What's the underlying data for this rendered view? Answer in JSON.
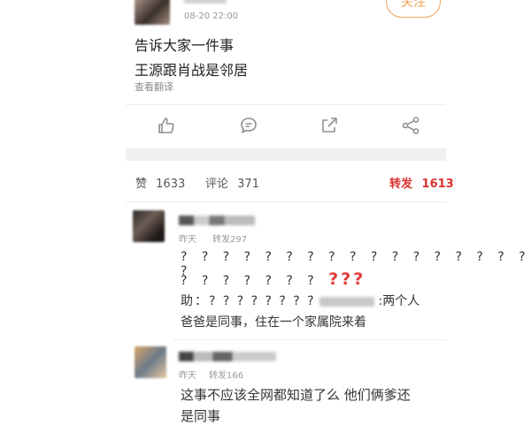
{
  "post": {
    "time": "08-20 22:00",
    "follow_label": "关注",
    "line1": "告诉大家一件事",
    "line2": "王源跟肖战是邻居",
    "translate_label": "查看翻译"
  },
  "stats": {
    "likes_label": "赞",
    "likes_count": "1633",
    "comments_label": "评论",
    "comments_count": "371",
    "reposts_label": "转发",
    "reposts_count": "1613"
  },
  "comments": [
    {
      "meta_time": "昨天",
      "meta_extra": "转发297",
      "q_line1": "? ? ? ? ? ? ? ? ? ? ? ? ? ? ? ? ? ?",
      "q_line2_plain": "? ? ? ? ? ? ?",
      "q_line2_red": "???",
      "reply_prefix": "助：? ? ? ? ? ? ? ?",
      "reply_suffix": ":两个人",
      "reply_line2": "爸爸是同事，住在一个家属院来着"
    },
    {
      "meta_time": "昨天",
      "meta_extra": "转发166",
      "line1": "这事不应该全网都知道了么 他们俩爹还",
      "line2": "是同事"
    }
  ],
  "icons": {
    "like": "thumbs-up-icon",
    "comment": "comment-icon",
    "repost": "share-out-icon",
    "share": "share-icon"
  },
  "colors": {
    "accent_red": "#d9322e",
    "follow_orange": "#f0a35a"
  }
}
